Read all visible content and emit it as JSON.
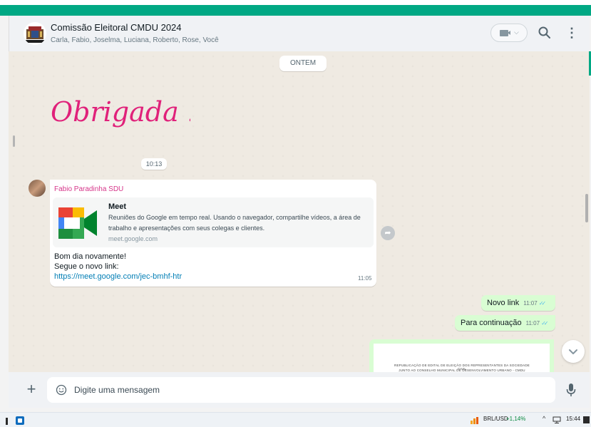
{
  "colors": {
    "accent": "#00a884",
    "outgoing_bubble": "#d9fdd3",
    "sender_name": "#d6368a",
    "link": "#027eb5",
    "sticker": "#e0217a"
  },
  "header": {
    "title": "Comissão Eleitoral CMDU 2024",
    "members": "Carla, Fabio, Joselma, Luciana, Roberto, Rose, Você",
    "video_chevron": "⌵",
    "menu_glyph": "⋮"
  },
  "chat": {
    "date_divider": "ONTEM",
    "sticker_text": "Obrigada !",
    "time_divider": "10:13",
    "incoming": {
      "sender": "Fabio Paradinha SDU",
      "preview": {
        "title": "Meet",
        "description": "Reuniões do Google em tempo real. Usando o navegador, compartilhe vídeos, a área de trabalho e apresentações com seus colegas e clientes.",
        "domain": "meet.google.com"
      },
      "lines": [
        "Bom dia novamente!",
        "Segue o novo link:"
      ],
      "link": "https://meet.google.com/jec-bmhf-htr",
      "time": "11:05"
    },
    "outgoing": [
      {
        "text": "Novo link",
        "time": "11:07",
        "ticks": "✓✓"
      },
      {
        "text": "Para continuação",
        "time": "11:07",
        "ticks": "✓✓"
      }
    ],
    "document_preview": {
      "line1": "REPUBLICAÇÃO DE EDITAL DE ELEIÇÃO DOS REPRESENTANTES DA SOCIEDADE CIVIL",
      "line2": "JUNTO AO CONSELHO MUNICIPAL DE DESENVOLVIMENTO URBANO - CMDU"
    }
  },
  "composer": {
    "plus": "+",
    "placeholder": "Digite uma mensagem"
  },
  "taskbar": {
    "pair": "BRL/USD",
    "change": "+1,14%",
    "chevron": "^",
    "time": "15:44"
  }
}
